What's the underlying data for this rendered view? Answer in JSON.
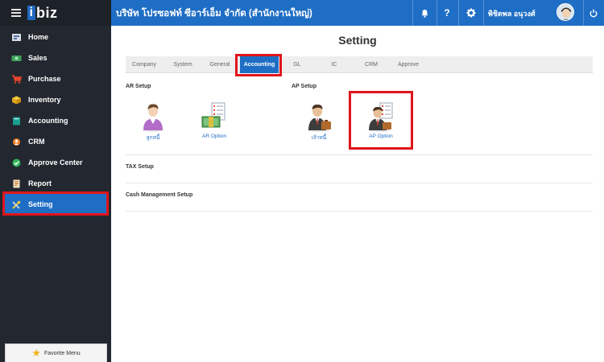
{
  "app": {
    "logo_i": "i",
    "logo_rest": "biz"
  },
  "sidebar": {
    "items": [
      {
        "label": "Home",
        "icon": "home-icon"
      },
      {
        "label": "Sales",
        "icon": "sales-icon"
      },
      {
        "label": "Purchase",
        "icon": "cart-icon"
      },
      {
        "label": "Inventory",
        "icon": "box-icon"
      },
      {
        "label": "Accounting",
        "icon": "book-icon"
      },
      {
        "label": "CRM",
        "icon": "crm-icon"
      },
      {
        "label": "Approve Center",
        "icon": "check-circle-icon"
      },
      {
        "label": "Report",
        "icon": "report-icon"
      },
      {
        "label": "Setting",
        "icon": "tools-icon",
        "active": true
      }
    ],
    "favorite_label": "Favorite Menu"
  },
  "header": {
    "company": "บริษัท โปรซอฟท์ ซีอาร์เอ็ม จำกัด (สำนักงานใหญ่)",
    "icons": [
      "bell-icon",
      "help-icon",
      "gear-icon"
    ],
    "help_glyph": "?",
    "username": "พิชิตพล อนุวงศ์"
  },
  "main": {
    "title": "Setting",
    "tabs": [
      {
        "label": "Company"
      },
      {
        "label": "System"
      },
      {
        "label": "General"
      },
      {
        "label": "Accounting",
        "active": true
      },
      {
        "label": "GL"
      },
      {
        "label": "IC"
      },
      {
        "label": "CRM"
      },
      {
        "label": "Approve"
      }
    ],
    "ar_setup": {
      "title": "AR Setup",
      "tiles": [
        {
          "label": "ลูกหนี้"
        },
        {
          "label": "AR Option"
        }
      ]
    },
    "ap_setup": {
      "title": "AP Setup",
      "tiles": [
        {
          "label": "เจ้าหนี้"
        },
        {
          "label": "AP Option"
        }
      ]
    },
    "tax_setup": {
      "title": "TAX Setup"
    },
    "cash_setup": {
      "title": "Cash Management Setup"
    }
  },
  "colors": {
    "sidebar_bg": "#232830",
    "accent": "#1f6ec5",
    "highlight": "#e0141c"
  }
}
